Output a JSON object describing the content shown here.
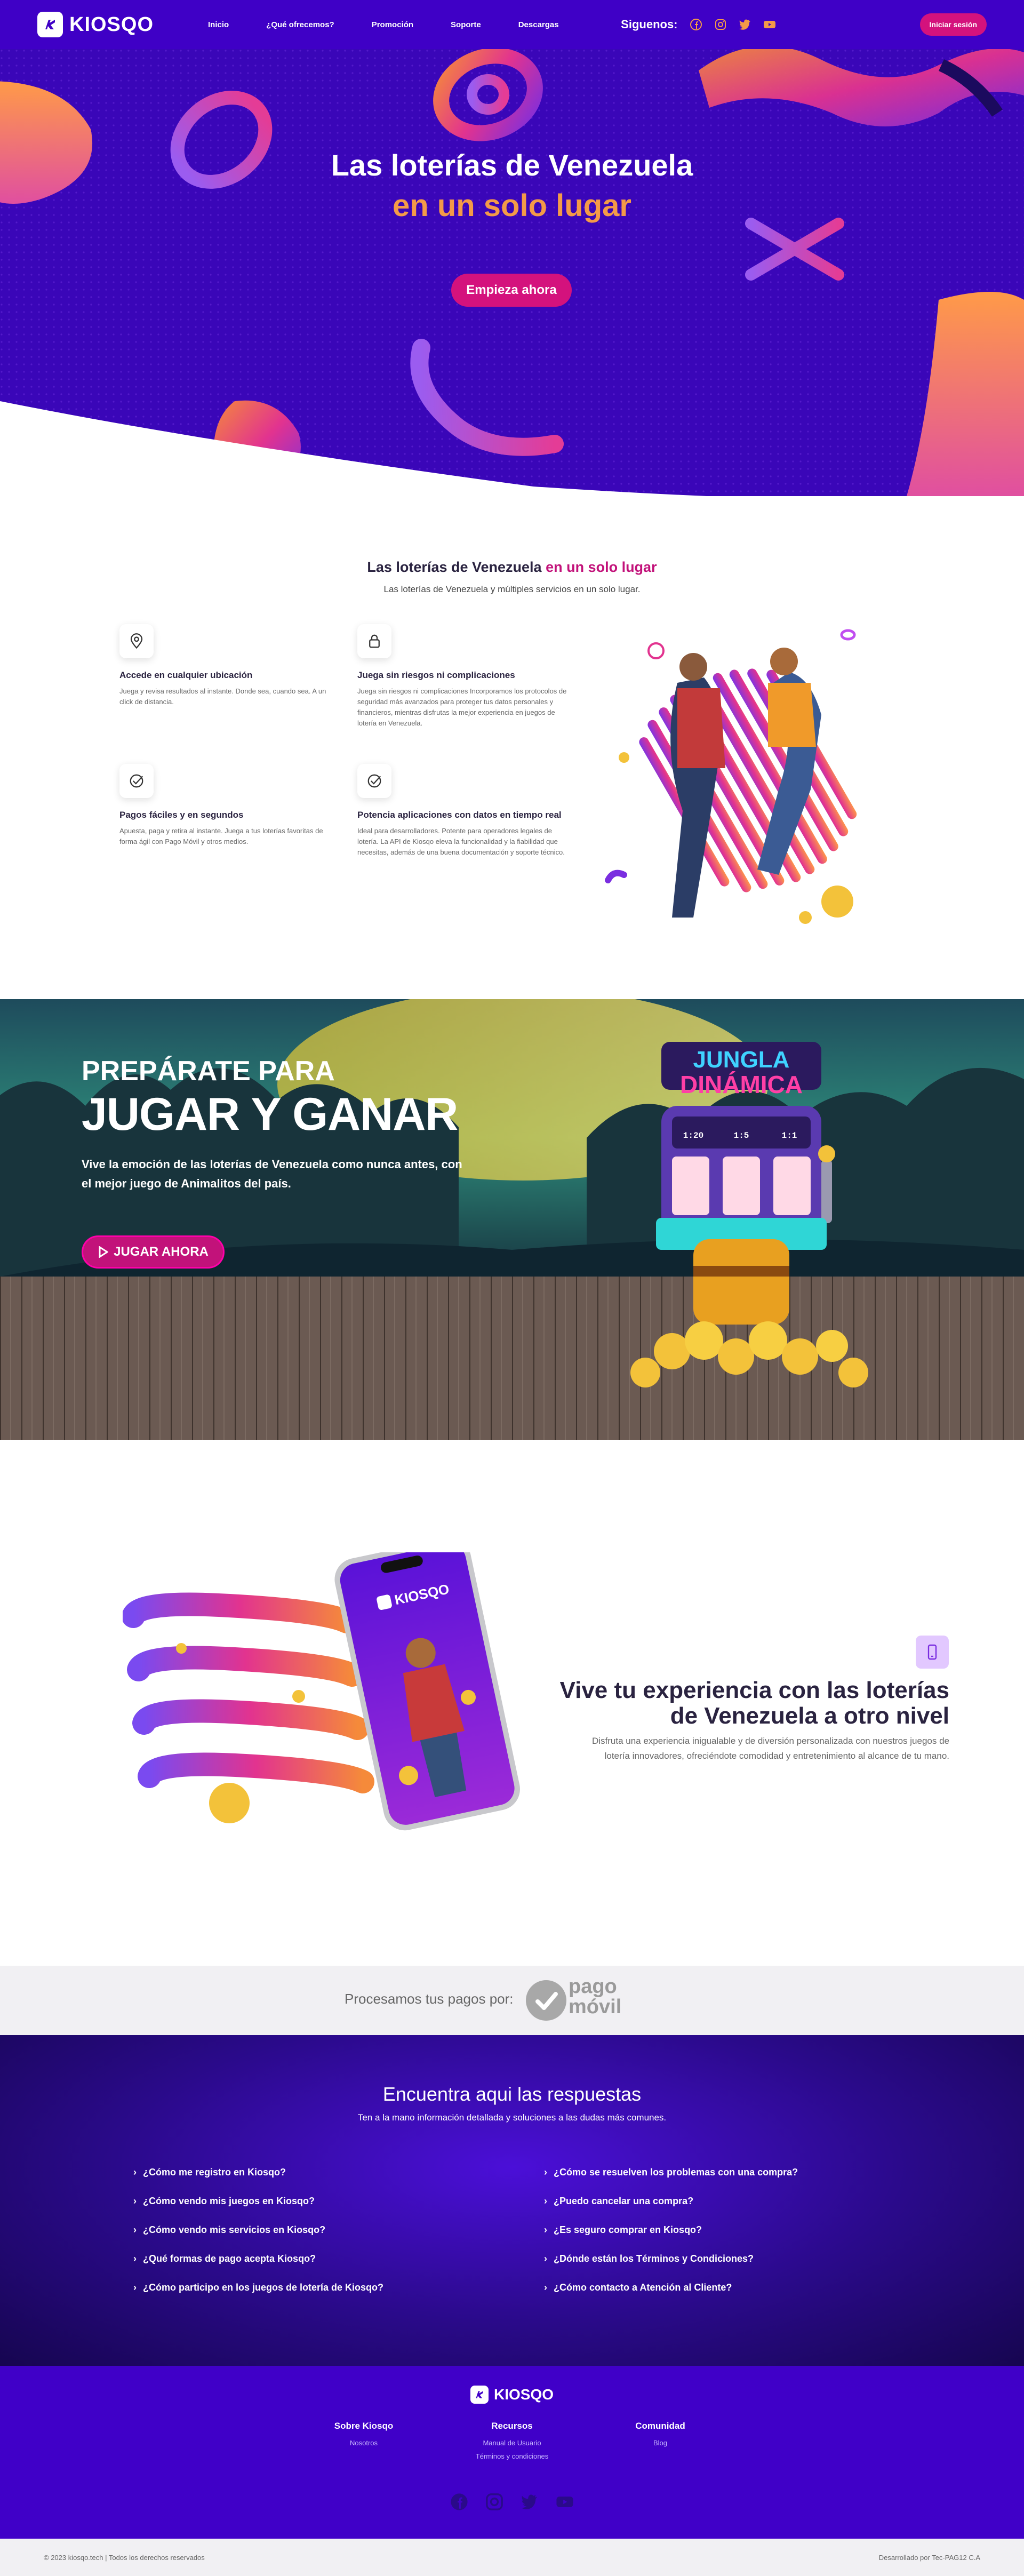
{
  "nav": {
    "brand": "KIOSQO",
    "links": [
      "Inicio",
      "¿Qué ofrecemos?",
      "Promoción",
      "Soporte",
      "Descargas"
    ],
    "follow_label": "Siguenos:",
    "social_icons": [
      "facebook-icon",
      "instagram-icon",
      "twitter-icon",
      "youtube-icon"
    ],
    "login_label": "Iniciar sesión"
  },
  "hero": {
    "title": "Las loterías de Venezuela",
    "subtitle": "en un solo lugar",
    "cta": "Empieza ahora"
  },
  "features": {
    "title_main": "Las loterías de Venezuela ",
    "title_accent": "en un solo lugar",
    "subtitle": "Las loterías de Venezuela y múltiples servicios en un solo lugar.",
    "items": [
      {
        "icon": "location-pin-icon",
        "title": "Accede en cualquier ubicación",
        "text": "Juega y revisa resultados al instante. Donde sea, cuando sea. A un click de distancia."
      },
      {
        "icon": "lock-icon",
        "title": "Juega sin riesgos ni complicaciones",
        "text": "Juega sin riesgos ni complicaciones Incorporamos los protocolos de seguridad más avanzados para proteger tus datos personales y financieros, mientras disfrutas la mejor experiencia en juegos de lotería en Venezuela."
      },
      {
        "icon": "check-circle-icon",
        "title": "Pagos fáciles y en segundos",
        "text": "Apuesta, paga y retira al instante. Juega a tus loterías favoritas de forma ágil con Pago Móvil y otros medios."
      },
      {
        "icon": "check-circle-icon",
        "title": "Potencia aplicaciones con datos en tiempo real",
        "text": "Ideal para desarrolladores. Potente para operadores legales de lotería. La API de Kiosqo eleva la funcionalidad y la fiabilidad que necesitas, además de una buena documentación y soporte técnico."
      }
    ]
  },
  "promo": {
    "line1": "PREPÁRATE PARA",
    "line2": "JUGAR Y GANAR",
    "text": "Vive la emoción de las loterías de Venezuela como nunca antes, con el mejor juego de Animalitos del país.",
    "cta": "JUGAR AHORA",
    "game_title_1": "JUNGLA",
    "game_title_2": "DINÁMICA",
    "reels": [
      "1:20",
      "1:5",
      "1:1"
    ]
  },
  "experience": {
    "phone_brand": "KIOSQO",
    "title": "Vive tu experiencia con las loterías de Venezuela a otro nivel",
    "text": "Disfruta una experiencia inigualable y de diversión personalizada con nuestros juegos de lotería innovadores, ofreciéndote comodidad y entretenimiento al alcance de tu mano."
  },
  "payments": {
    "label": "Procesamos tus pagos por:",
    "brand_line1": "pago",
    "brand_line2": "móvil"
  },
  "faq": {
    "title": "Encuentra aqui las respuestas",
    "subtitle": "Ten a la mano información detallada y soluciones a las dudas más comunes.",
    "left": [
      "¿Cómo me registro en Kiosqo?",
      "¿Cómo vendo mis juegos en Kiosqo?",
      "¿Cómo vendo mis servicios en Kiosqo?",
      "¿Qué formas de pago acepta Kiosqo?",
      "¿Cómo participo en los juegos de lotería de Kiosqo?"
    ],
    "right": [
      "¿Cómo se resuelven los problemas con una compra?",
      "¿Puedo cancelar una compra?",
      "¿Es seguro comprar en Kiosqo?",
      "¿Dónde están los Términos y Condiciones?",
      "¿Cómo contacto a Atención al Cliente?"
    ]
  },
  "footer": {
    "brand": "KIOSQO",
    "columns": [
      {
        "title": "Sobre Kiosqo",
        "links": [
          "Nosotros"
        ]
      },
      {
        "title": "Recursos",
        "links": [
          "Manual de Usuario",
          "Términos y condiciones"
        ]
      },
      {
        "title": "Comunidad",
        "links": [
          "Blog"
        ]
      }
    ],
    "copyright": "© 2023 kiosqo.tech | Todos los derechos reservados",
    "credit": "Desarrollado por Tec-PAG12 C.A"
  },
  "colors": {
    "primary": "#3f00c6",
    "accent_pink": "#d4127d",
    "accent_orange": "#f49a48"
  }
}
